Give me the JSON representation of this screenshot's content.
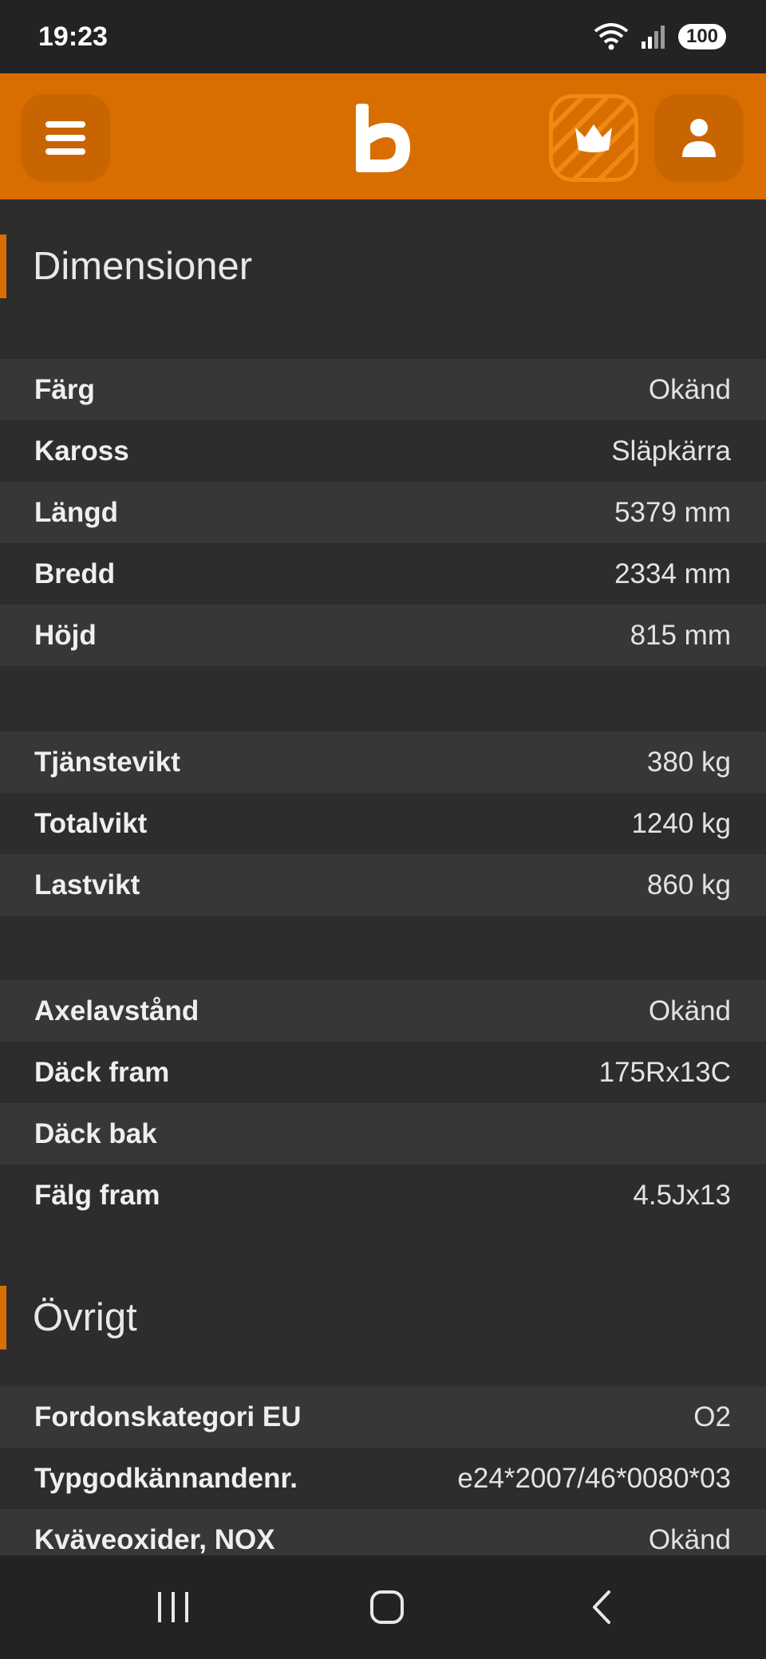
{
  "status_bar": {
    "time": "19:23",
    "battery": "100",
    "icons": [
      "wifi-icon",
      "signal-icon"
    ]
  },
  "header": {
    "icons": [
      "menu-icon",
      "brand-logo",
      "crown-icon",
      "user-icon"
    ],
    "accent_color": "#d86e00"
  },
  "sections": {
    "dimensions": {
      "title": "Dimensioner",
      "groups": [
        [
          {
            "label": "Färg",
            "value": "Okänd"
          },
          {
            "label": "Kaross",
            "value": "Släpkärra"
          },
          {
            "label": "Längd",
            "value": "5379 mm"
          },
          {
            "label": "Bredd",
            "value": "2334 mm"
          },
          {
            "label": "Höjd",
            "value": "815 mm"
          }
        ],
        [
          {
            "label": "Tjänstevikt",
            "value": "380 kg"
          },
          {
            "label": "Totalvikt",
            "value": "1240 kg"
          },
          {
            "label": "Lastvikt",
            "value": "860 kg"
          }
        ],
        [
          {
            "label": "Axelavstånd",
            "value": "Okänd"
          },
          {
            "label": "Däck fram",
            "value": "175Rx13C"
          },
          {
            "label": "Däck bak",
            "value": ""
          },
          {
            "label": "Fälg fram",
            "value": "4.5Jx13"
          }
        ]
      ]
    },
    "other": {
      "title": "Övrigt",
      "rows": [
        {
          "label": "Fordonskategori EU",
          "value": "O2"
        },
        {
          "label": "Typgodkännandenr.",
          "value": "e24*2007/46*0080*03"
        },
        {
          "label": "Kväveoxider, NOX",
          "value": "Okänd"
        }
      ]
    }
  },
  "nav_bar": {
    "icons": [
      "recent-apps-icon",
      "home-icon",
      "back-icon"
    ]
  }
}
